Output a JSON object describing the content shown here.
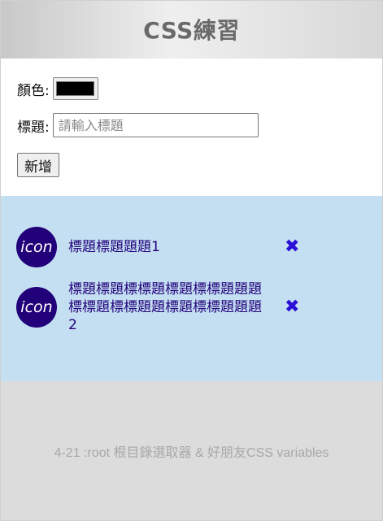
{
  "header": {
    "title": "CSS練習"
  },
  "form": {
    "color_label": "顏色:",
    "color_value": "#000000",
    "title_label": "標題:",
    "title_placeholder": "請輸入標題",
    "title_value": "",
    "add_button_label": "新增"
  },
  "list": {
    "items": [
      {
        "icon_text": "icon",
        "title": "標題標題題題1",
        "delete_label": "✖"
      },
      {
        "icon_text": "icon",
        "title": "標題標題標標題標題標標題題題標標題標標題題標題標標題題題2",
        "delete_label": "✖"
      }
    ],
    "colors": {
      "background": "#c4dff2",
      "accent": "#22007a",
      "delete": "#2a0fd6"
    }
  },
  "footer": {
    "text": "4-21 :root 根目錄選取器 & 好朋友CSS variables"
  }
}
